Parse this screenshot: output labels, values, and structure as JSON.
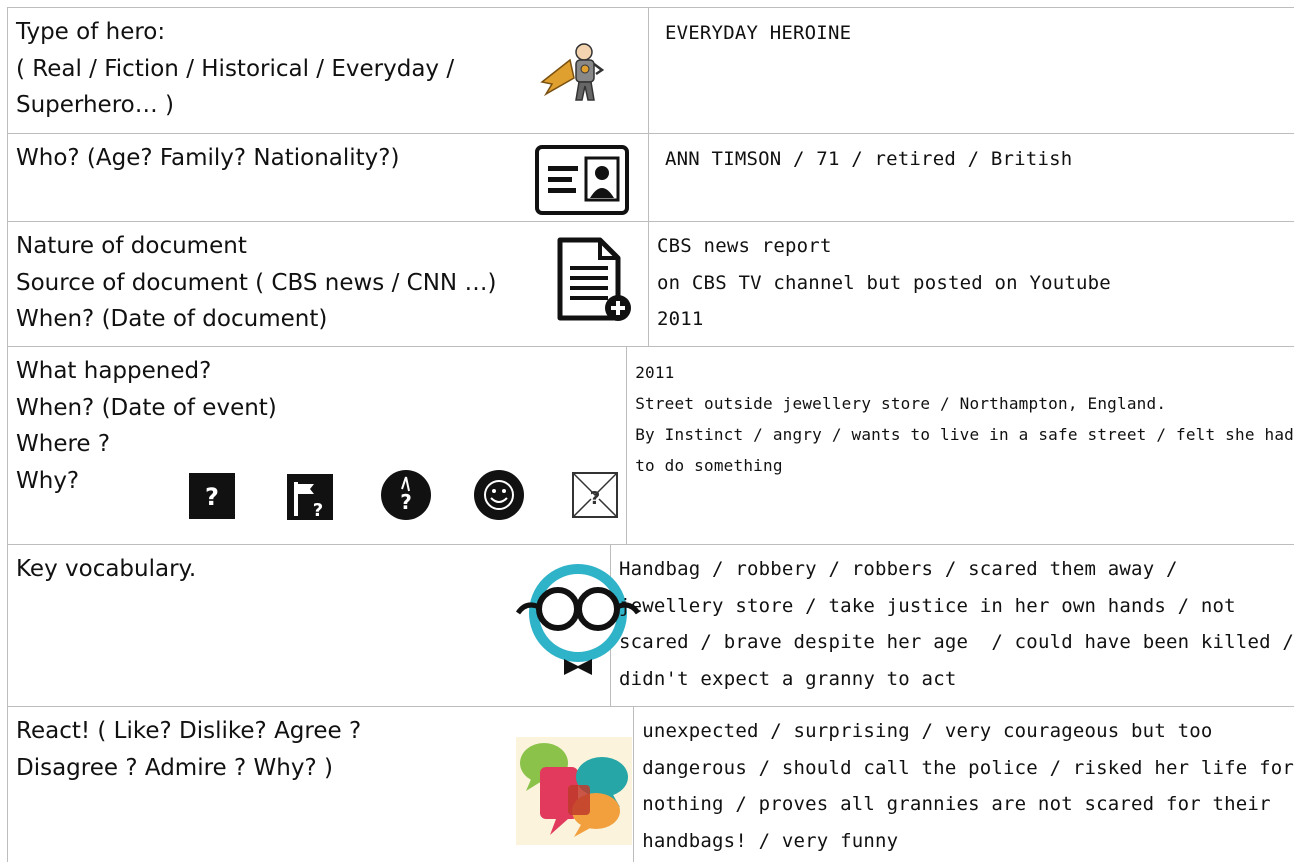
{
  "rows": [
    {
      "question_lines": [
        "Type of hero:",
        "( Real / Fiction / Historical / Everyday /",
        "Superhero… )"
      ],
      "answer_lines": [
        "EVERYDAY HEROINE"
      ],
      "icon": "superhero-icon"
    },
    {
      "question_lines": [
        "Who? (Age? Family? Nationality?)"
      ],
      "answer_lines": [
        "ANN TIMSON / 71 / retired / British"
      ],
      "icon": "id-card-icon"
    },
    {
      "question_lines": [
        "Nature of document",
        "Source of document ( CBS news / CNN …)",
        "When? (Date of document)"
      ],
      "answer_lines": [
        "CBS news report",
        "on CBS TV channel but posted on Youtube",
        "2011"
      ],
      "icon": "add-document-icon"
    },
    {
      "question_lines": [
        "What happened?",
        "When? (Date of event)",
        "Where ?",
        "Why?"
      ],
      "answer_lines": [
        "2011",
        "Street outside jewellery store / Northampton, England.",
        "By Instinct / angry / wants to live in a safe street / felt she had",
        "to do something"
      ],
      "icons": [
        "question-box-icon",
        "location-question-icon",
        "clock-question-icon",
        "smiley-icon",
        "envelope-question-icon"
      ]
    },
    {
      "question_lines": [
        "Key vocabulary."
      ],
      "answer_lines": [
        "Handbag / robbery / robbers / scared them away /",
        "jewellery store / take justice in her own hands / not",
        "scared / brave despite her age  / could have been killed /",
        "didn't expect a granny to act"
      ],
      "icon": "glasses-character-icon"
    },
    {
      "question_lines": [
        "React! ( Like? Dislike? Agree ?",
        "Disagree ? Admire ? Why? )"
      ],
      "answer_lines": [
        "unexpected / surprising / very courageous but too",
        "dangerous / should call the police / risked her life for",
        "nothing / proves all grannies are not scared for their",
        "handbags! / very funny"
      ],
      "icon": "speech-bubbles-icon"
    }
  ],
  "colors": {
    "border": "#bdbdbd",
    "accent_cyan": "#2fb3c9",
    "bubble_green": "#8bc34a",
    "bubble_red": "#e23a5c",
    "bubble_teal": "#26a6a6",
    "bubble_orange": "#f2a03d"
  }
}
